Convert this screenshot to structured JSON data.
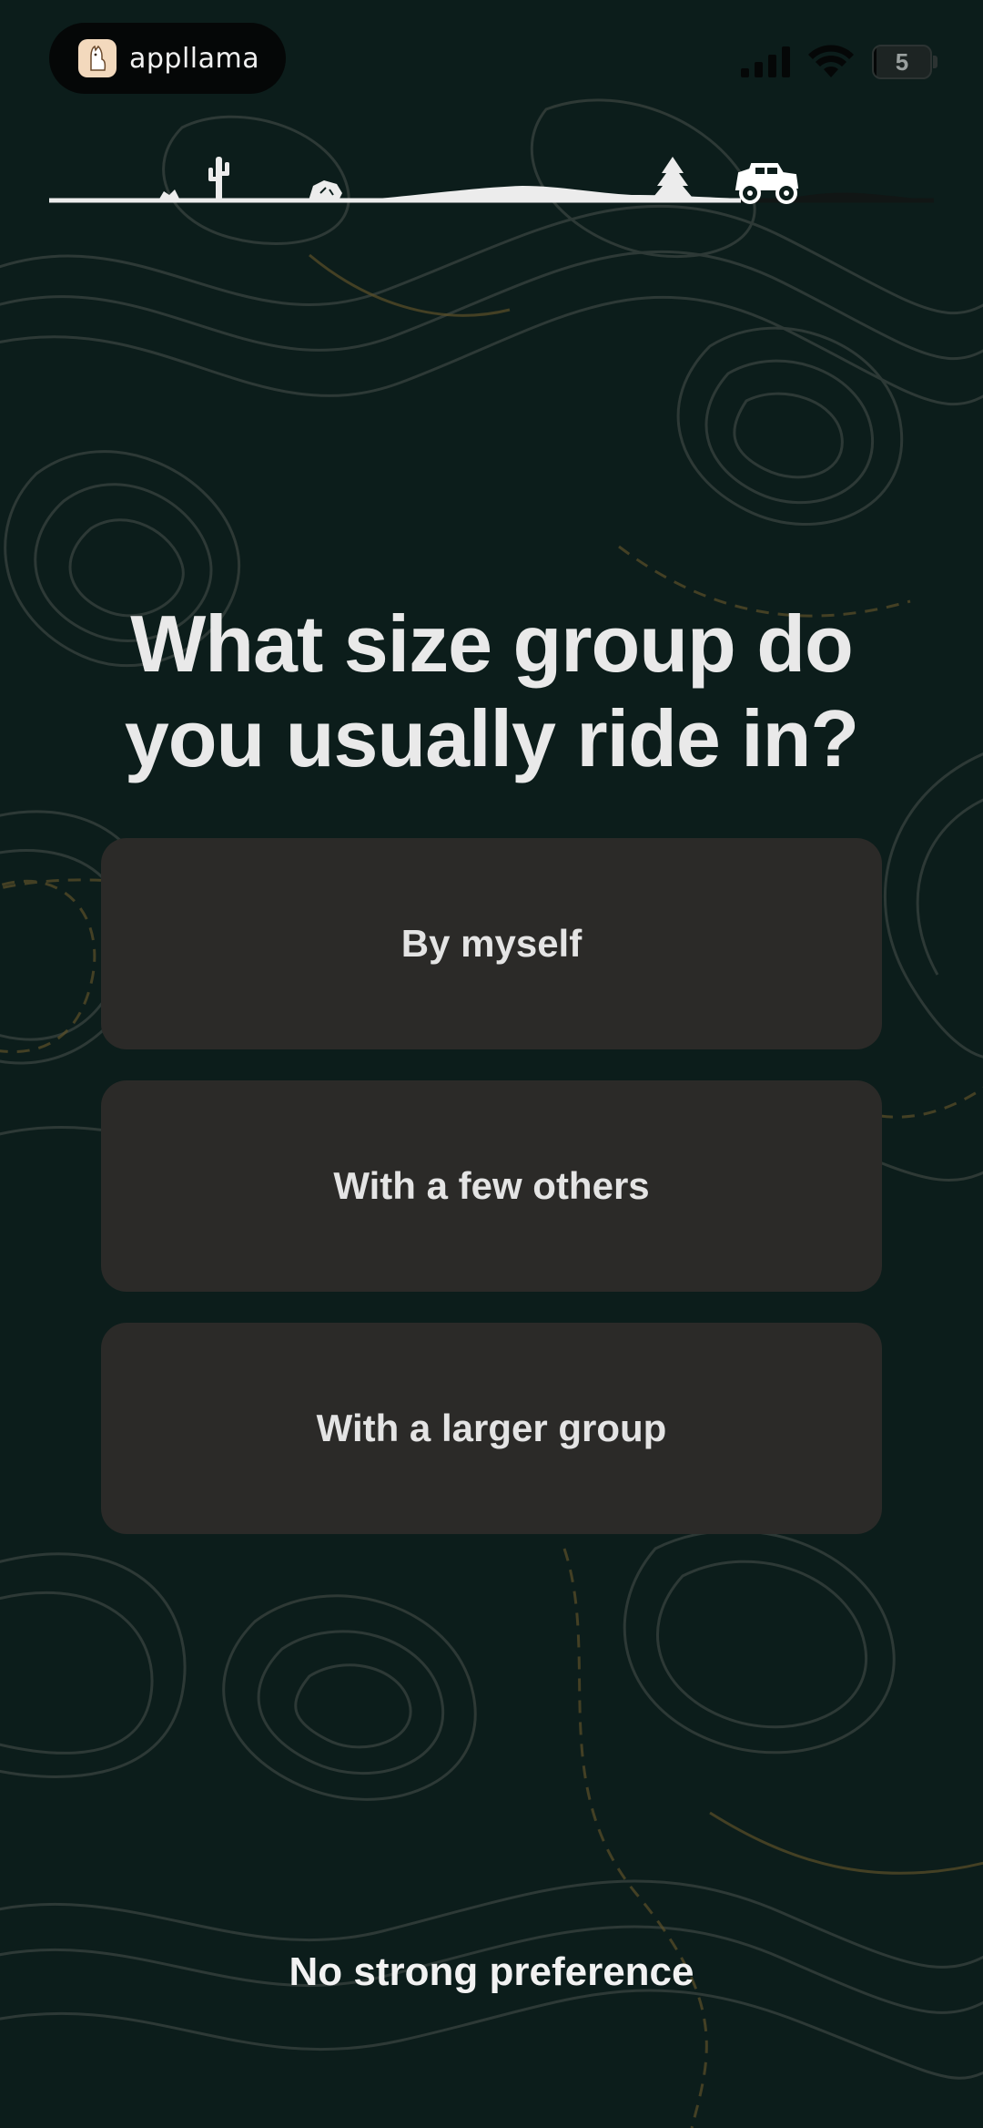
{
  "status_bar": {
    "app_name": "appllama",
    "app_icon": "llama-icon",
    "battery_level": "5",
    "battery_fraction": 0.05,
    "signal_icon": "cellular-signal-icon",
    "wifi_icon": "wifi-icon"
  },
  "progress": {
    "fraction": 0.8,
    "icons": [
      "cactus-icon",
      "rock-icon",
      "pine-tree-icon",
      "jeep-icon"
    ]
  },
  "question": {
    "title": "What size group do you usually ride in?"
  },
  "options": [
    {
      "label": "By myself"
    },
    {
      "label": "With a few others"
    },
    {
      "label": "With a larger group"
    }
  ],
  "skip_label": "No strong preference",
  "colors": {
    "background": "#0c1d1b",
    "card": "#2b2a28",
    "text": "#e9e9e9",
    "contour": "#3d4745",
    "contour_accent": "#6b5a24"
  }
}
